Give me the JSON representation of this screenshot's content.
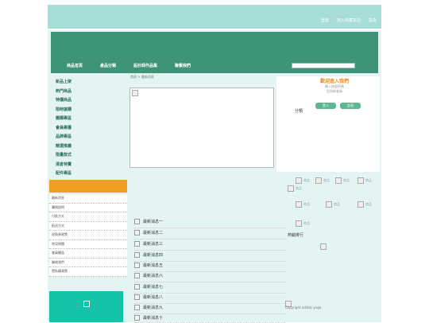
{
  "top_links": [
    "登陸",
    "加入收藏本店",
    "設為"
  ],
  "nav": {
    "items": [
      "商品首頁",
      "產品分類",
      "設計師作品集",
      "聯繫我們"
    ],
    "search_placeholder": ""
  },
  "left_menu": [
    "新品上架",
    "熱門商品",
    "特價商品",
    "限時搶購",
    "團購專區",
    "會員專屬",
    "品牌專區",
    "精選推薦",
    "限量款式",
    "清倉特賣",
    "配件專區",
    "預購專區"
  ],
  "left_list": [
    "最新消息",
    "購物說明",
    "付款方式",
    "配送方式",
    "退換貨政策",
    "常見問題",
    "會員權益",
    "聯絡我們",
    "隱私權政策",
    "服務條款"
  ],
  "breadcrumb": "首頁 > 最新消息",
  "welcome": {
    "title": "歡迎進入我們",
    "line1": "輸入帳號密碼",
    "line2": "註冊新會員",
    "btn1": "登入",
    "btn2": "註冊"
  },
  "category_label": "分類",
  "thumb_labels": [
    "商品",
    "商品",
    "商品",
    "商品",
    "商品",
    "商品",
    "商品",
    "商品",
    "商品"
  ],
  "main_list": [
    "最新消息一",
    "最新消息二",
    "最新消息三",
    "最新消息四",
    "最新消息五",
    "最新消息六",
    "最新消息七",
    "最新消息八",
    "最新消息九",
    "最新消息十"
  ],
  "rank_label": "熱銷排行",
  "credit": "Copyright adidas yoga"
}
